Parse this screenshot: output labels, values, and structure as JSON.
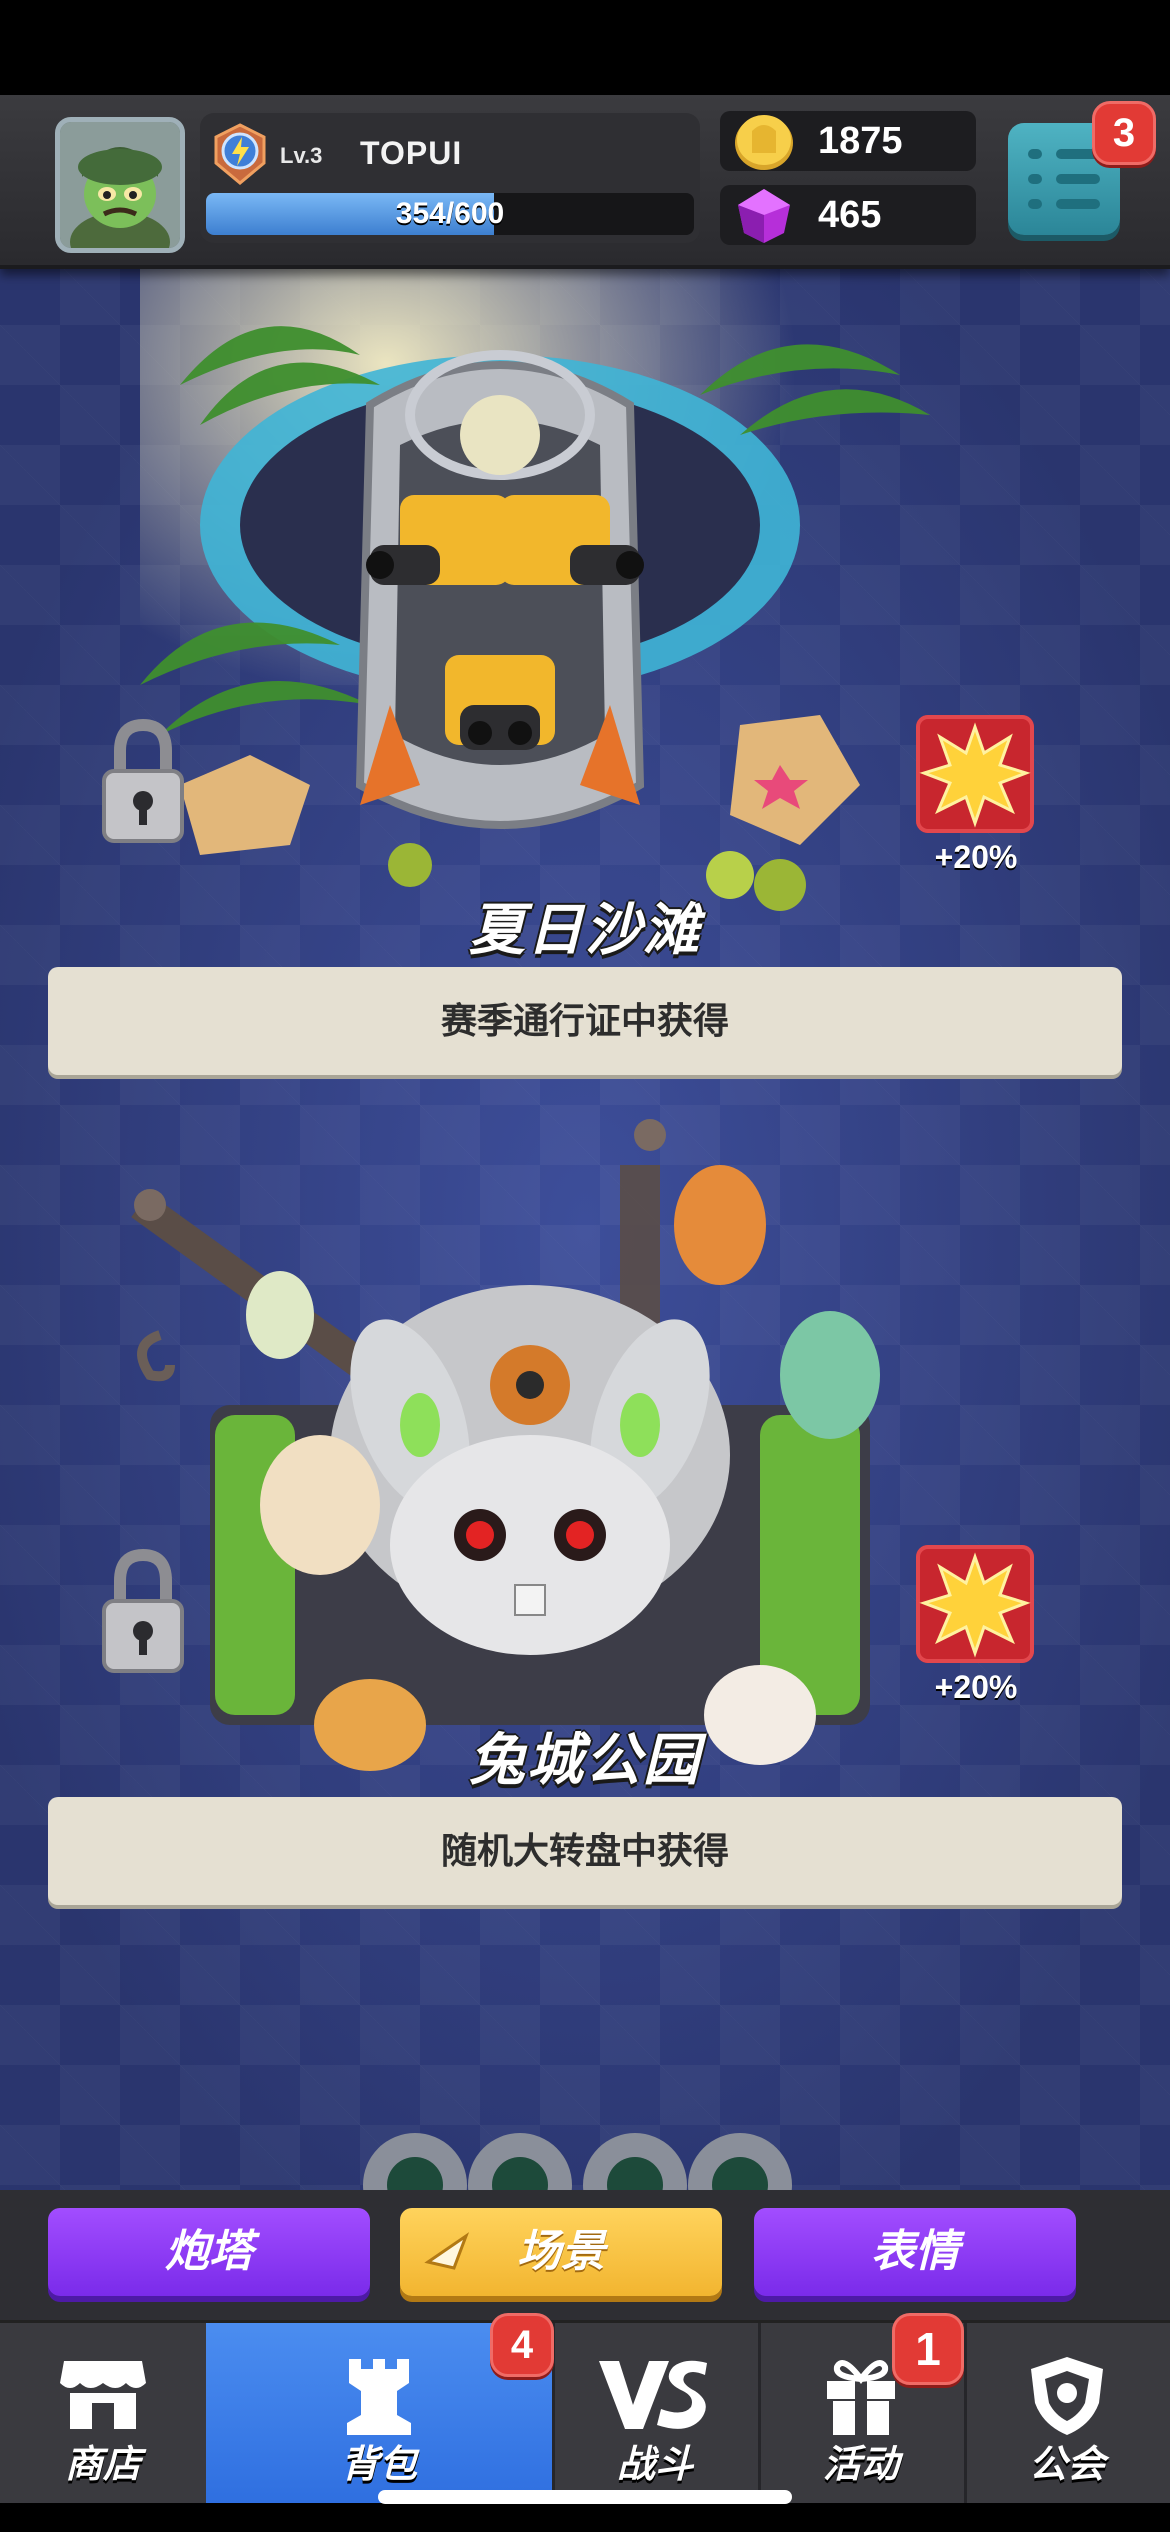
{
  "player": {
    "level": "Lv.3",
    "name": "TOPUI",
    "xp_text": "354/600",
    "xp_fraction": 0.59
  },
  "currency": {
    "gold": "1875",
    "gems": "465"
  },
  "menu": {
    "badge": "3"
  },
  "scenes": [
    {
      "title": "夏日沙滩",
      "source": "赛季通行证中获得",
      "bonus": "+20%"
    },
    {
      "title": "兔城公园",
      "source": "随机大转盘中获得",
      "bonus": "+20%"
    }
  ],
  "sub_tabs": {
    "turret": "炮塔",
    "scene": "场景",
    "emote": "表情"
  },
  "nav": {
    "shop": "商店",
    "backpack": "背包",
    "backpack_badge": "4",
    "battle": "战斗",
    "activity": "活动",
    "activity_badge": "1",
    "guild": "公会"
  },
  "colors": {
    "accent_blue": "#2f6fe0",
    "purple": "#7a2bea",
    "yellow": "#f2b530",
    "badge_red": "#e23a35",
    "bonus_red": "#c8262e"
  }
}
